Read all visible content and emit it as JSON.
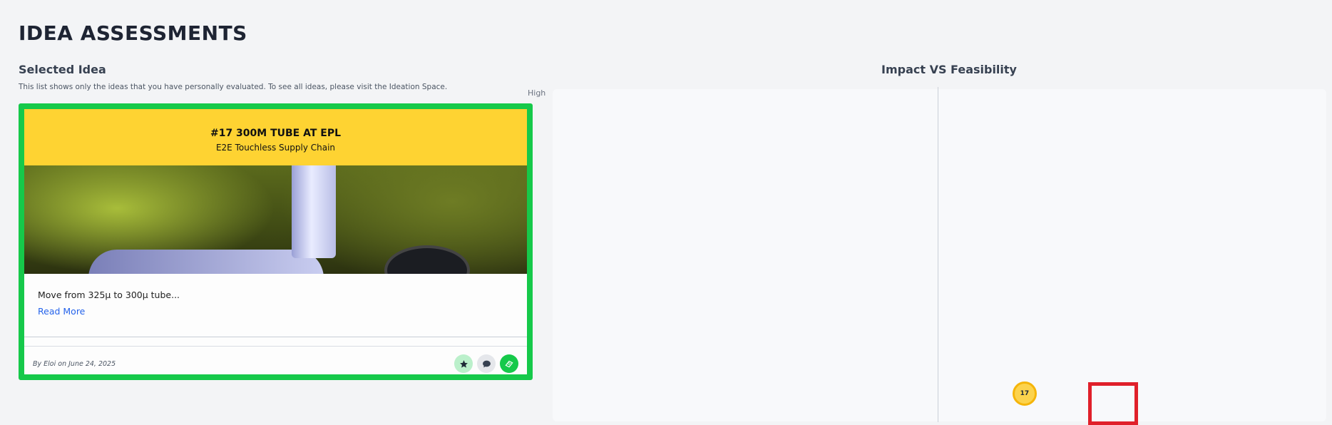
{
  "page": {
    "title": "IDEA ASSESSMENTS",
    "section_title": "Selected Idea",
    "section_note": "This list shows only the ideas that you have personally evaluated. To see all ideas, please visit the Ideation Space.",
    "chart_title": "Impact VS Feasibility"
  },
  "idea_card": {
    "title": "#17 300M TUBE AT EPL",
    "subtitle": "E2E Touchless Supply Chain",
    "description": "Move from 325µ to 300µ tube...",
    "read_more": "Read More",
    "byline": "By Eloi on June 24, 2025",
    "actions": [
      "star-icon",
      "comment-icon",
      "evaluate-icon"
    ],
    "accent_color": "#16c94a",
    "header_color": "#fed332"
  },
  "matrix": {
    "axis_label_high": "High",
    "points": [
      {
        "label": "17",
        "feasibility_fraction": 0.61,
        "impact_fraction": 0.02
      }
    ],
    "point_color": "#fcd34d"
  }
}
